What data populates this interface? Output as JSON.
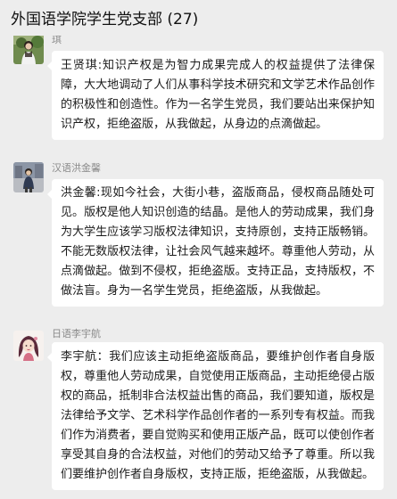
{
  "header": {
    "title": "外国语学院学生党支部 (27)"
  },
  "messages": [
    {
      "sender": "琪",
      "avatar": "avatar-woman-outdoor",
      "text": "王贤琪:知识产权是为智力成果完成人的权益提供了法律保障，大大地调动了人们从事科学技术研究和文学艺术作品创作的积极性和创造性。作为一名学生党员，我们要站出来保护知识产权，拒绝盗版，从我做起，从身边的点滴做起。"
    },
    {
      "sender": "汉语洪金馨",
      "avatar": "avatar-girl-street",
      "text": "洪金馨:现如今社会，大街小巷，盗版商品，侵权商品随处可见。版权是他人知识创造的结晶。是他人的劳动成果，我们身为大学生应该学习版权法律知识，支持原创，支持正版畅销。不能无数版权法律，让社会风气越来越坏。尊重他人劳动，从点滴做起。做到不侵权，拒绝盗版。支持正品，支持版权，不做法盲。身为一名学生党员，拒绝盗版，从我做起。"
    },
    {
      "sender": "日语李宇航",
      "avatar": "avatar-cartoon-girl",
      "text": "李宇航：我们应该主动拒绝盗版商品，要维护创作者自身版权，尊重他人劳动成果，自觉使用正版商品，主动拒绝侵占版权的商品，抵制非合法权益出售的商品，我们要知道，版权是法律给予文学、艺术科学作品创作者的一系列专有权益。而我们作为消费者，要自觉购买和使用正版产品，既可以使创作者享受其自身的合法权益，对他们的劳动又给予了尊重。所以我们要维护创作者自身版权，支持正版，拒绝盗版，从我做起。"
    }
  ]
}
